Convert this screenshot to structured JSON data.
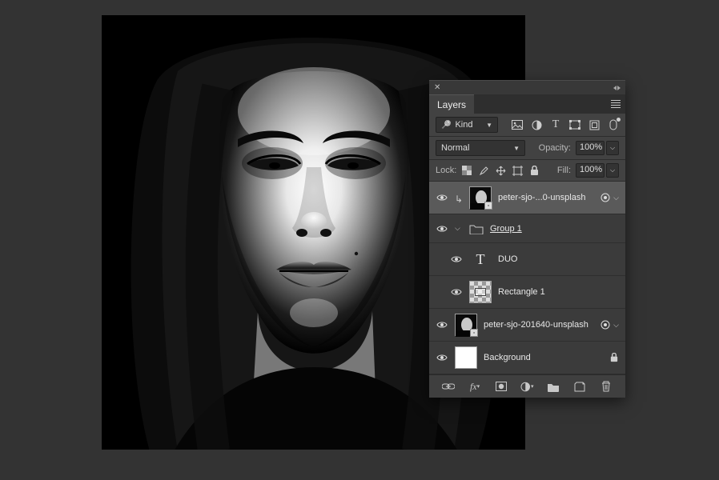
{
  "panel": {
    "tab_label": "Layers",
    "filter": {
      "mode_label": "Kind"
    },
    "blend": {
      "mode": "Normal",
      "opacity_label": "Opacity:",
      "opacity_value": "100%"
    },
    "lock": {
      "label": "Lock:",
      "fill_label": "Fill:",
      "fill_value": "100%"
    },
    "layers": [
      {
        "name": "peter-sjo-...0-unsplash",
        "selected": true,
        "type": "smart",
        "clipping": true,
        "expand": true
      },
      {
        "name": "Group 1",
        "type": "group",
        "expanded": true
      },
      {
        "name": "DUO",
        "type": "text"
      },
      {
        "name": "Rectangle 1",
        "type": "shape"
      },
      {
        "name": "peter-sjo-201640-unsplash",
        "type": "smart",
        "expand": true
      },
      {
        "name": "Background",
        "type": "bg",
        "locked": true
      }
    ],
    "icons": {
      "image": "image-icon",
      "adjust": "circle-half-icon",
      "type": "type-icon",
      "shape": "shape-icon",
      "smart": "smart-object-icon",
      "artboard": "artboard-icon"
    }
  }
}
